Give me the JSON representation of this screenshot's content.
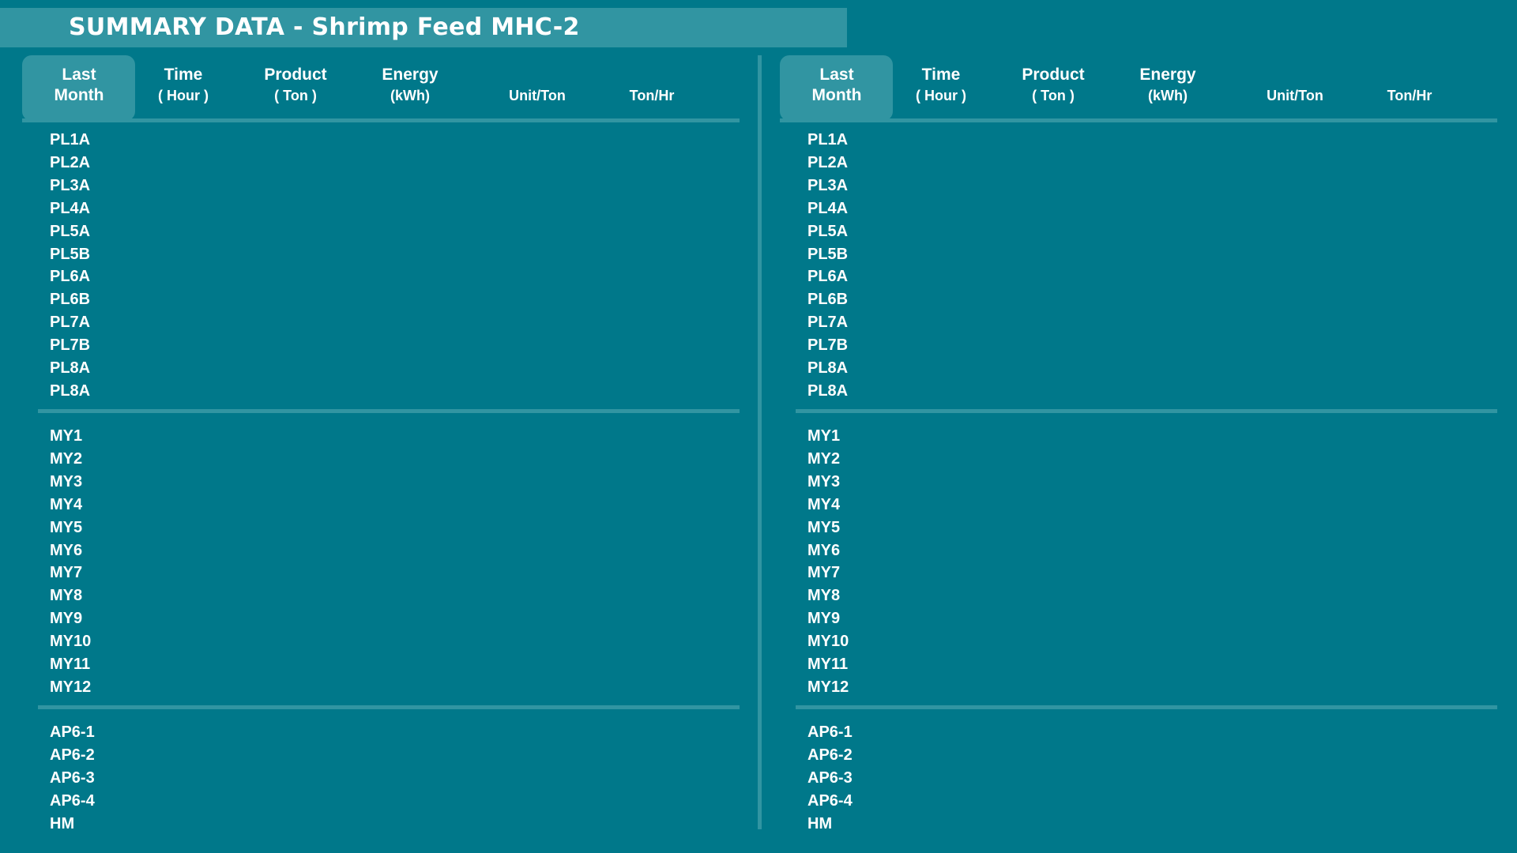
{
  "title": "SUMMARY DATA - Shrimp Feed MHC-2",
  "colors": {
    "background": "#00788a",
    "accent": "#3195a2",
    "text": "#ffffff"
  },
  "panels": [
    {
      "columns": [
        {
          "line1": "Last",
          "line2": "Month"
        },
        {
          "line1": "Time",
          "line2": "( Hour )"
        },
        {
          "line1": "Product",
          "line2": "( Ton )"
        },
        {
          "line1": "Energy",
          "line2": "(kWh)"
        },
        {
          "line1": "",
          "line2": "Unit/Ton"
        },
        {
          "line1": "",
          "line2": "Ton/Hr"
        }
      ],
      "groups": [
        {
          "rows": [
            "PL1A",
            "PL2A",
            "PL3A",
            "PL4A",
            "PL5A",
            "PL5B",
            "PL6A",
            "PL6B",
            "PL7A",
            "PL7B",
            "PL8A",
            "PL8A"
          ]
        },
        {
          "rows": [
            "MY1",
            "MY2",
            "MY3",
            "MY4",
            "MY5",
            "MY6",
            "MY7",
            "MY8",
            "MY9",
            "MY10",
            "MY11",
            "MY12"
          ]
        },
        {
          "rows": [
            "AP6-1",
            "AP6-2",
            "AP6-3",
            "AP6-4",
            "HM"
          ]
        }
      ]
    },
    {
      "columns": [
        {
          "line1": "Last",
          "line2": "Month"
        },
        {
          "line1": "Time",
          "line2": "( Hour )"
        },
        {
          "line1": "Product",
          "line2": "( Ton )"
        },
        {
          "line1": "Energy",
          "line2": "(kWh)"
        },
        {
          "line1": "",
          "line2": "Unit/Ton"
        },
        {
          "line1": "",
          "line2": "Ton/Hr"
        }
      ],
      "groups": [
        {
          "rows": [
            "PL1A",
            "PL2A",
            "PL3A",
            "PL4A",
            "PL5A",
            "PL5B",
            "PL6A",
            "PL6B",
            "PL7A",
            "PL7B",
            "PL8A",
            "PL8A"
          ]
        },
        {
          "rows": [
            "MY1",
            "MY2",
            "MY3",
            "MY4",
            "MY5",
            "MY6",
            "MY7",
            "MY8",
            "MY9",
            "MY10",
            "MY11",
            "MY12"
          ]
        },
        {
          "rows": [
            "AP6-1",
            "AP6-2",
            "AP6-3",
            "AP6-4",
            "HM"
          ]
        }
      ]
    }
  ]
}
